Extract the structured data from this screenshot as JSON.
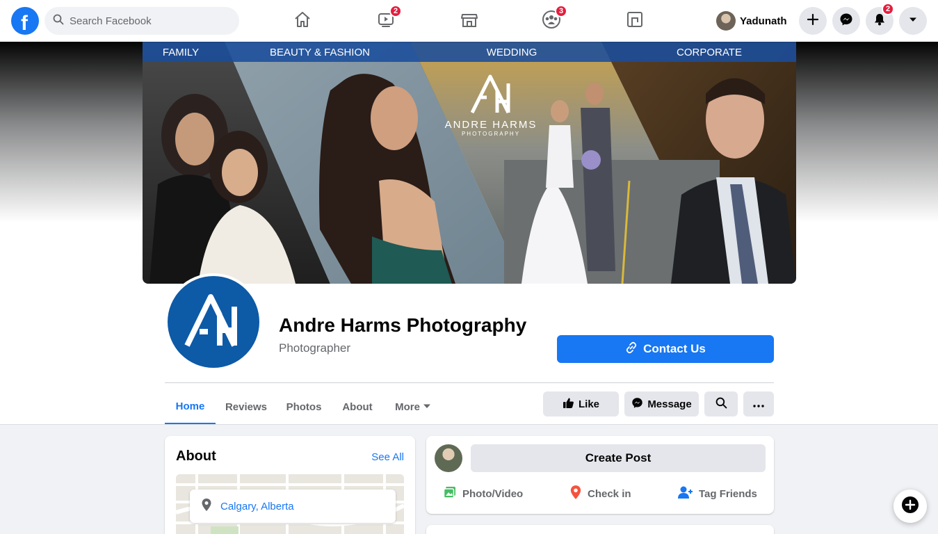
{
  "topbar": {
    "search_placeholder": "Search Facebook",
    "watch_badge": "2",
    "groups_badge": "3",
    "notifications_badge": "2",
    "profile_name": "Yadunath"
  },
  "cover": {
    "categories": [
      "FAMILY",
      "BEAUTY & FASHION",
      "WEDDING",
      "CORPORATE"
    ],
    "brand_main": "ANDRE HARMS",
    "brand_sub": "PHOTOGRAPHY"
  },
  "page": {
    "name": "Andre Harms Photography",
    "category": "Photographer",
    "contact_label": "Contact Us"
  },
  "tabs": [
    "Home",
    "Reviews",
    "Photos",
    "About",
    "More"
  ],
  "actions": {
    "like": "Like",
    "message": "Message"
  },
  "about": {
    "title": "About",
    "see_all": "See All",
    "location": "Calgary, Alberta"
  },
  "create_post": {
    "label": "Create Post",
    "photo_video": "Photo/Video",
    "check_in": "Check in",
    "tag_friends": "Tag Friends"
  },
  "colors": {
    "facebook_blue": "#1877f2",
    "badge_red": "#e41e3f",
    "brand_blue": "#0d5aa7",
    "cover_bar": "#1a4d9c"
  }
}
